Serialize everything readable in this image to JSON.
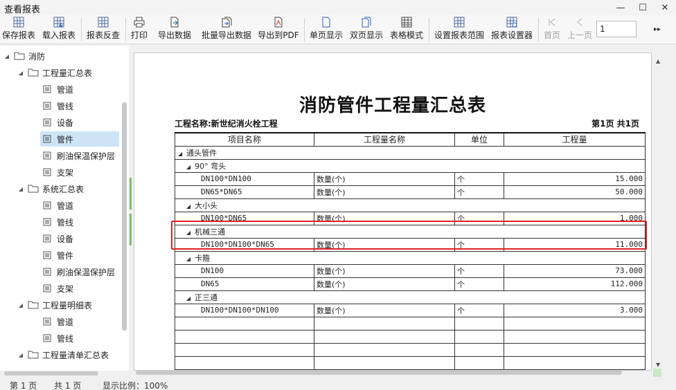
{
  "window": {
    "title": "查看报表"
  },
  "toolbar": {
    "save_report": "保存报表",
    "load_report": "载入报表",
    "report_reverse": "报表反查",
    "print": "打印",
    "export_data": "导出数据",
    "batch_export": "批量导出数据",
    "export_pdf": "导出到PDF",
    "single_page": "单页显示",
    "double_page": "双页显示",
    "table_mode": "表格模式",
    "set_range": "设置报表范围",
    "report_settings": "报表设置器",
    "first_page": "首页",
    "prev_page": "上一页",
    "page_value": "1"
  },
  "tree": {
    "root": "消防",
    "groups": [
      {
        "label": "工程量汇总表",
        "items": [
          "管道",
          "管线",
          "设备",
          "管件",
          "刷油保温保护层",
          "支架"
        ]
      },
      {
        "label": "系统汇总表",
        "items": [
          "管道",
          "管线",
          "设备",
          "管件",
          "刷油保温保护层",
          "支架"
        ]
      },
      {
        "label": "工程量明细表",
        "items": [
          "管道",
          "管线"
        ]
      },
      {
        "label": "工程量清单汇总表",
        "items": []
      }
    ]
  },
  "report": {
    "title": "消防管件工程量汇总表",
    "project": "工程名称:新世纪消火栓工程",
    "page_info": "第1页  共1页",
    "headers": [
      "项目名称",
      "工程量名称",
      "单位",
      "工程量"
    ],
    "rows": [
      {
        "level": 1,
        "name": "通头管件"
      },
      {
        "level": 2,
        "name": "90° 弯头"
      },
      {
        "level": 3,
        "name": "DN100*DN100",
        "qty_name": "数量(个)",
        "unit": "个",
        "qty": "15.000"
      },
      {
        "level": 3,
        "name": "DN65*DN65",
        "qty_name": "数量(个)",
        "unit": "个",
        "qty": "50.000"
      },
      {
        "level": 2,
        "name": "大小头"
      },
      {
        "level": 3,
        "name": "DN100*DN65",
        "qty_name": "数量(个)",
        "unit": "个",
        "qty": "1.000"
      },
      {
        "level": 2,
        "name": "机械三通"
      },
      {
        "level": 3,
        "name": "DN100*DN100*DN65",
        "qty_name": "数量(个)",
        "unit": "个",
        "qty": "11.000"
      },
      {
        "level": 2,
        "name": "卡箍"
      },
      {
        "level": 3,
        "name": "DN100",
        "qty_name": "数量(个)",
        "unit": "个",
        "qty": "73.000"
      },
      {
        "level": 3,
        "name": "DN65",
        "qty_name": "数量(个)",
        "unit": "个",
        "qty": "112.000"
      },
      {
        "level": 2,
        "name": "正三通"
      },
      {
        "level": 3,
        "name": "DN100*DN100*DN100",
        "qty_name": "数量(个)",
        "unit": "个",
        "qty": "3.000"
      }
    ]
  },
  "status": {
    "page_label": "第  1  页",
    "total_label": "共  1  页",
    "zoom_label": "显示比例：100%"
  }
}
